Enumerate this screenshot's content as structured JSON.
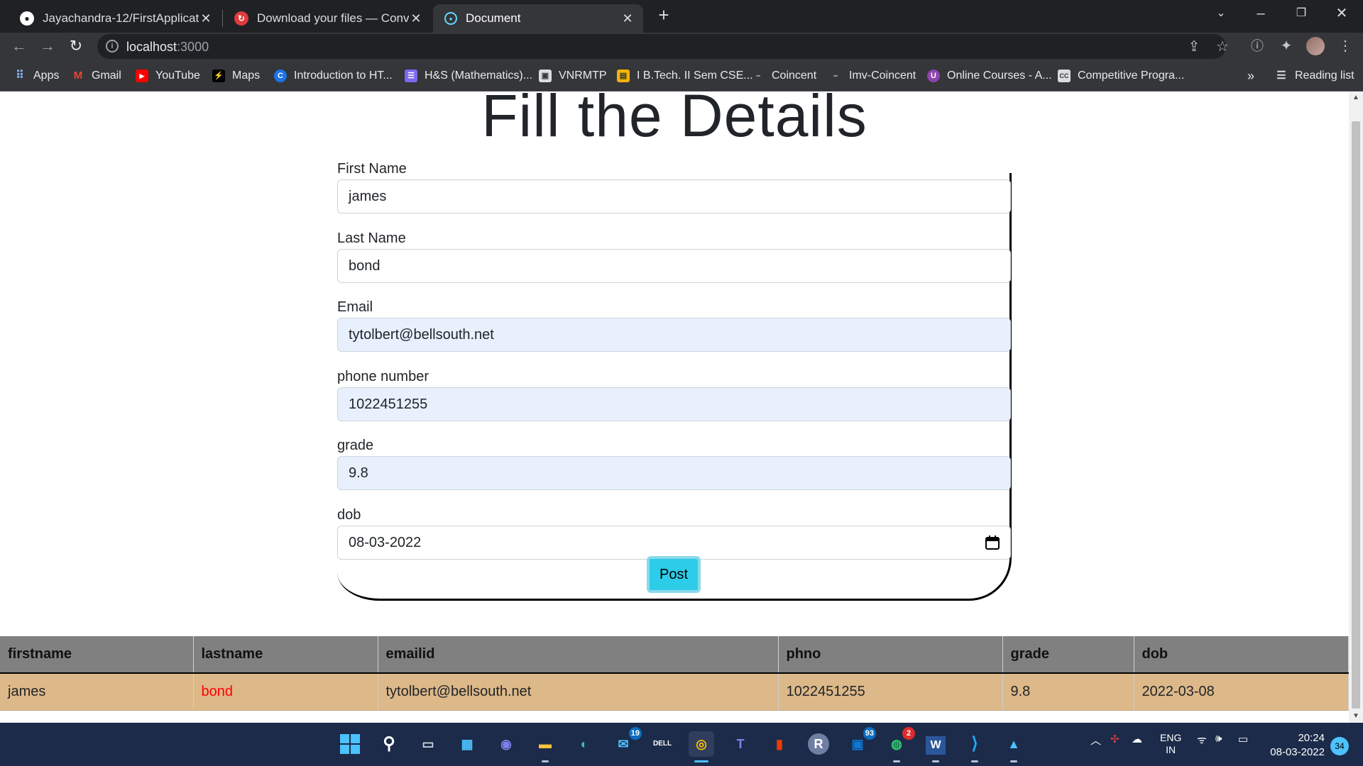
{
  "browser": {
    "tabs": [
      {
        "title": "Jayachandra-12/FirstApplication",
        "icon": "github-icon"
      },
      {
        "title": "Download your files — Convertio",
        "icon": "convertio-icon"
      },
      {
        "title": "Document",
        "icon": "react-icon"
      }
    ],
    "url_host": "localhost",
    "url_port": ":3000",
    "bookmarks": [
      "Apps",
      "Gmail",
      "YouTube",
      "Maps",
      "Introduction to HT...",
      "H&S (Mathematics)...",
      "VNRMTP",
      "I B.Tech. II Sem CSE...",
      "Coincent",
      "Imv-Coincent",
      "Online Courses - A...",
      "Competitive Progra..."
    ],
    "bookmarks_more": "»",
    "reading_list": "Reading list"
  },
  "page": {
    "heading": "Fill the Details",
    "form": {
      "first_name_label": "First Name",
      "first_name_value": "james",
      "last_name_label": "Last Name",
      "last_name_value": "bond",
      "email_label": "Email",
      "email_value": "tytolbert@bellsouth.net",
      "phone_label": "phone number",
      "phone_value": "1022451255",
      "grade_label": "grade",
      "grade_value": "9.8",
      "dob_label": "dob",
      "dob_value": "08-03-2022",
      "post_label": "Post"
    },
    "table": {
      "headers": [
        "firstname",
        "lastname",
        "emailid",
        "phno",
        "grade",
        "dob"
      ],
      "rows": [
        [
          "james",
          "bond",
          "tytolbert@bellsouth.net",
          "1022451255",
          "9.8",
          "2022-03-08"
        ]
      ]
    }
  },
  "taskbar": {
    "badges": {
      "mail": "19",
      "outlook": "93",
      "whatsapp": "2"
    },
    "lang": "ENG",
    "region": "IN",
    "time": "20:24",
    "date": "08-03-2022",
    "notifications": "34"
  }
}
